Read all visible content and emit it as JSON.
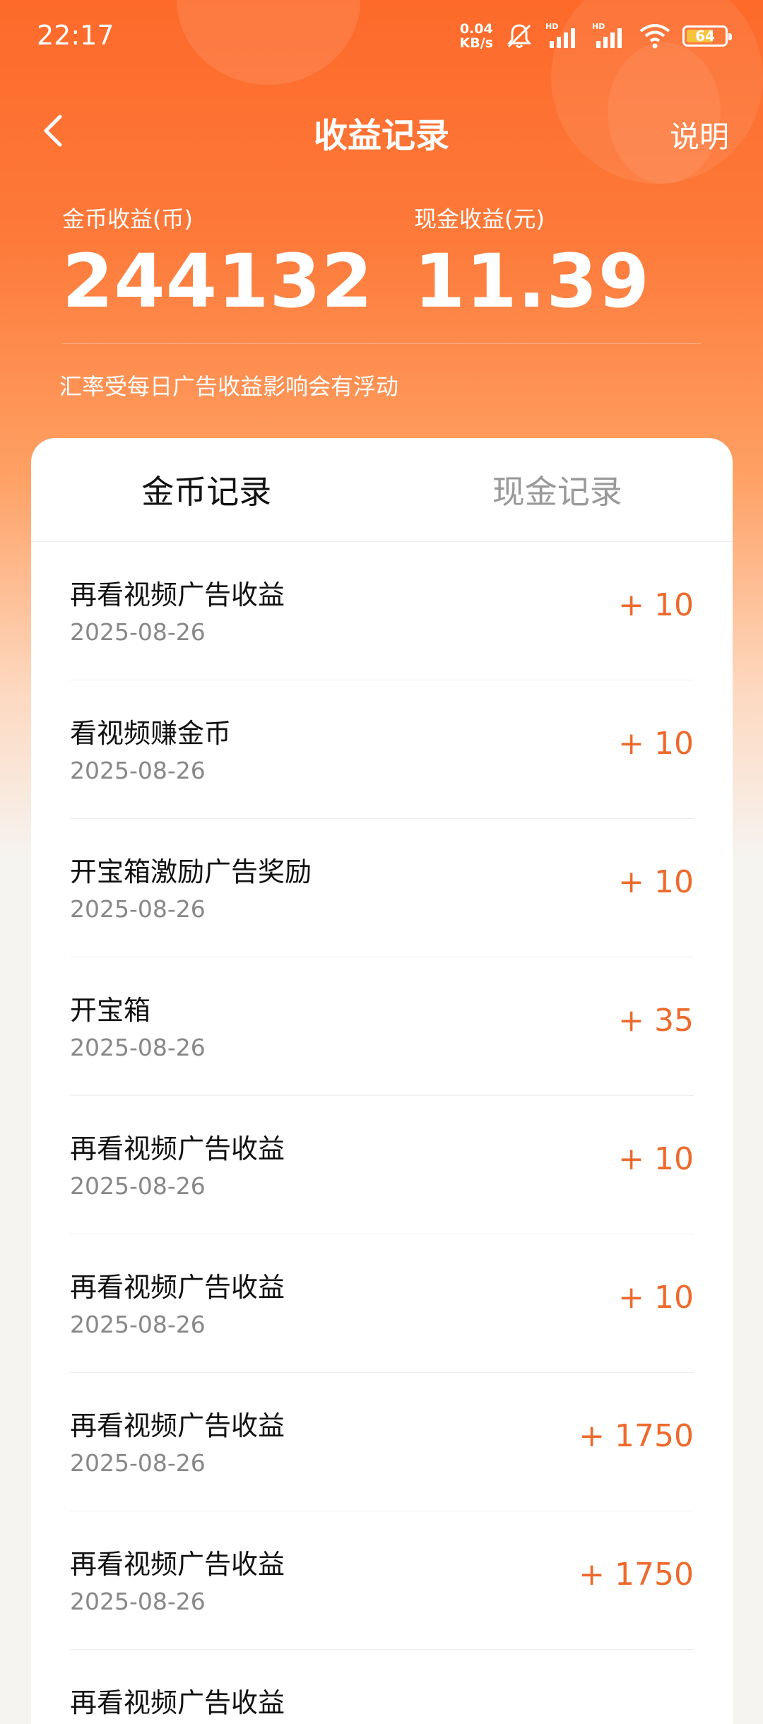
{
  "status_bar": {
    "time": "22:17",
    "net_speed_value": "0.04",
    "net_speed_unit": "KB/s",
    "battery": "64",
    "icons": [
      "mute-bell-icon",
      "signal-hd-icon",
      "signal-hd-icon",
      "wifi-icon",
      "battery-icon"
    ]
  },
  "nav": {
    "title": "收益记录",
    "explain_label": "说明",
    "back_icon": "chevron-left-icon"
  },
  "summary": {
    "coin_label": "金币收益(币)",
    "coin_value": "244132",
    "cash_label": "现金收益(元)",
    "cash_value": "11.39",
    "rate_note": "汇率受每日广告收益影响会有浮动"
  },
  "tabs": [
    {
      "label": "金币记录",
      "active": true
    },
    {
      "label": "现金记录",
      "active": false
    }
  ],
  "records": [
    {
      "title": "再看视频广告收益",
      "date": "2025-08-26",
      "amount": "+ 10"
    },
    {
      "title": "看视频赚金币",
      "date": "2025-08-26",
      "amount": "+ 10"
    },
    {
      "title": "开宝箱激励广告奖励",
      "date": "2025-08-26",
      "amount": "+ 10"
    },
    {
      "title": "开宝箱",
      "date": "2025-08-26",
      "amount": "+ 35"
    },
    {
      "title": "再看视频广告收益",
      "date": "2025-08-26",
      "amount": "+ 10"
    },
    {
      "title": "再看视频广告收益",
      "date": "2025-08-26",
      "amount": "+ 10"
    },
    {
      "title": "再看视频广告收益",
      "date": "2025-08-26",
      "amount": "+ 1750"
    },
    {
      "title": "再看视频广告收益",
      "date": "2025-08-26",
      "amount": "+ 1750"
    },
    {
      "title": "再看视频广告收益",
      "date": "",
      "amount": ""
    }
  ],
  "colors": {
    "brand": "#fd6a2a",
    "amount": "#ee6a2c",
    "battery_fill": "#f7c23c"
  }
}
